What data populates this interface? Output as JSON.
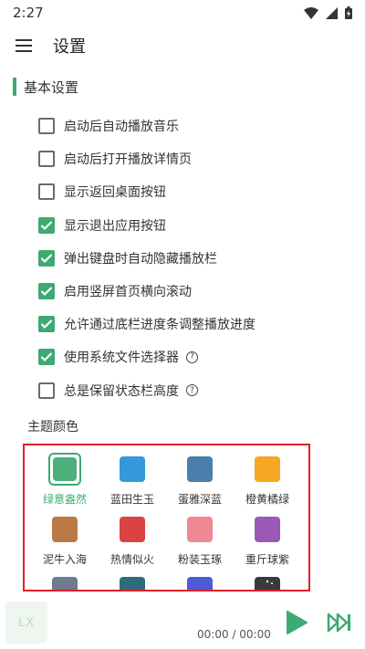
{
  "status": {
    "time": "2:27"
  },
  "header": {
    "title": "设置",
    "menu_icon": "hamburger-menu-icon"
  },
  "section": {
    "title": "基本设置"
  },
  "options": [
    {
      "label": "启动后自动播放音乐",
      "checked": false,
      "help": false
    },
    {
      "label": "启动后打开播放详情页",
      "checked": false,
      "help": false
    },
    {
      "label": "显示返回桌面按钮",
      "checked": false,
      "help": false
    },
    {
      "label": "显示退出应用按钮",
      "checked": true,
      "help": false
    },
    {
      "label": "弹出键盘时自动隐藏播放栏",
      "checked": true,
      "help": false
    },
    {
      "label": "启用竖屏首页横向滚动",
      "checked": true,
      "help": false
    },
    {
      "label": "允许通过底栏进度条调整播放进度",
      "checked": true,
      "help": false
    },
    {
      "label": "使用系统文件选择器",
      "checked": true,
      "help": true
    },
    {
      "label": "总是保留状态栏高度",
      "checked": false,
      "help": true
    }
  ],
  "theme": {
    "label": "主题颜色",
    "items": [
      {
        "name": "绿意盎然",
        "color": "#4daf7c",
        "selected": true
      },
      {
        "name": "蓝田生玉",
        "color": "#3498db",
        "selected": false
      },
      {
        "name": "蛋雅深蓝",
        "color": "#4a7fab",
        "selected": false
      },
      {
        "name": "橙黄橘绿",
        "color": "#f5a623",
        "selected": false
      },
      {
        "name": "泥牛入海",
        "color": "#b97a45",
        "selected": false
      },
      {
        "name": "热情似火",
        "color": "#d94343",
        "selected": false
      },
      {
        "name": "粉装玉琢",
        "color": "#ef8794",
        "selected": false
      },
      {
        "name": "重斤球紫",
        "color": "#9b59b6",
        "selected": false
      },
      {
        "name": "",
        "color": "#6f7b8f",
        "selected": false
      },
      {
        "name": "",
        "color": "#2e6c7a",
        "selected": false
      },
      {
        "name": "",
        "color": "#4f5bd5",
        "selected": false
      },
      {
        "name": "",
        "color": "#3a3a3a",
        "selected": false
      }
    ]
  },
  "player": {
    "logo_text": "LX",
    "time": "00:00 / 00:00",
    "accent": "#3daa72"
  }
}
